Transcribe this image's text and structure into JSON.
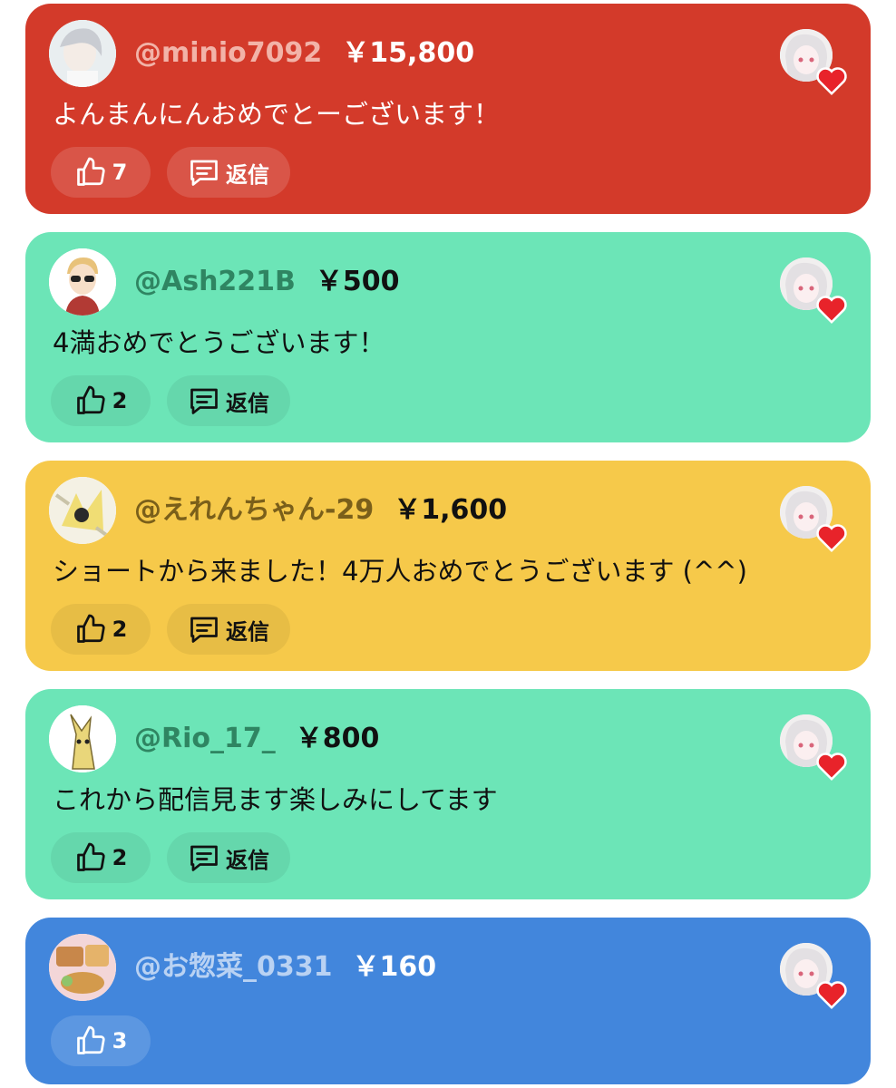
{
  "reply_label": "返信",
  "comments": [
    {
      "user": "@minio7092",
      "amount": "￥15,800",
      "message": "よんまんにんおめでとーございます！",
      "likes": "7",
      "color": "#d33a2a"
    },
    {
      "user": "@Ash221B",
      "amount": "￥500",
      "message": "4満おめでとうございます！",
      "likes": "2",
      "color": "#6ce5b7"
    },
    {
      "user": "@えれんちゃん-29",
      "amount": "￥1,600",
      "message": "ショートから来ました！4万人おめでとうございます (^^)",
      "likes": "2",
      "color": "#f6c94a"
    },
    {
      "user": "@Rio_17_",
      "amount": "￥800",
      "message": "これから配信見ます楽しみにしてます",
      "likes": "2",
      "color": "#6ce5b7"
    },
    {
      "user": "@お惣菜_0331",
      "amount": "￥160",
      "likes": "3",
      "color": "#4286dc"
    }
  ],
  "icons": {
    "like": "thumbs-up-icon",
    "reply": "comment-icon",
    "creator_heart": "heart-icon"
  }
}
